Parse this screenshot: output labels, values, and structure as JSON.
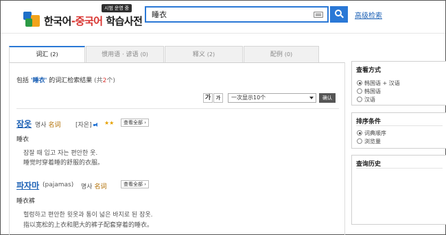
{
  "header": {
    "logo_text_a": "한국어",
    "logo_text_dash": "-",
    "logo_text_b": "중국어",
    "logo_text_c": " 학습사전",
    "logo_badge": "시범 운영 중",
    "search_value": "睡衣",
    "advanced_search": "高级检索"
  },
  "tabs": [
    {
      "label": "词汇",
      "count": "(2)",
      "active": true
    },
    {
      "label": "惯用语 · 谚语",
      "count": "(0)"
    },
    {
      "label": "释义",
      "count": "(2)"
    },
    {
      "label": "配例",
      "count": "(0)"
    }
  ],
  "summary": {
    "prefix": "包括 ",
    "keyword": "'睡衣'",
    "middle": " 的词汇检索结果 ",
    "open": "(共",
    "count": "2",
    "close": "个)"
  },
  "toolbar": {
    "font_large": "가",
    "font_small": "가",
    "page_size": "一次显示10个",
    "confirm": "确认"
  },
  "entries": [
    {
      "headword": "잠옷",
      "pos_ko": "명사",
      "pos_zh": "名词",
      "origin": "[자온]",
      "stars": "★★",
      "view_all": "查看全部 ›",
      "meaning": "睡衣",
      "def_ko": "잠잘 때 입고 자는 편안한 옷.",
      "def_zh": "睡觉时穿着睡的舒服的衣服。"
    },
    {
      "headword": "파자마",
      "origin": "(pajamas)",
      "pos_ko": "명사",
      "pos_zh": "名词",
      "view_all": "查看全部 ›",
      "meaning": "睡衣裤",
      "def_ko": "헐렁하고 편안한 윗옷과 통이 넓은 바지로 된 잠옷.",
      "def_zh": "指以宽松的上衣和肥大的裤子配套穿着的睡衣。"
    }
  ],
  "sidebar": {
    "view_mode": {
      "title": "查看方式",
      "options": [
        "韩国语 + 汉语",
        "韩国语",
        "汉语"
      ]
    },
    "sort": {
      "title": "排序条件",
      "options": [
        "词典顺序",
        "浏览量"
      ]
    },
    "history": {
      "title": "查询历史"
    }
  },
  "colors": {
    "accent": "#2a78d6",
    "highlight": "#d8332f",
    "star": "#e6a000"
  }
}
